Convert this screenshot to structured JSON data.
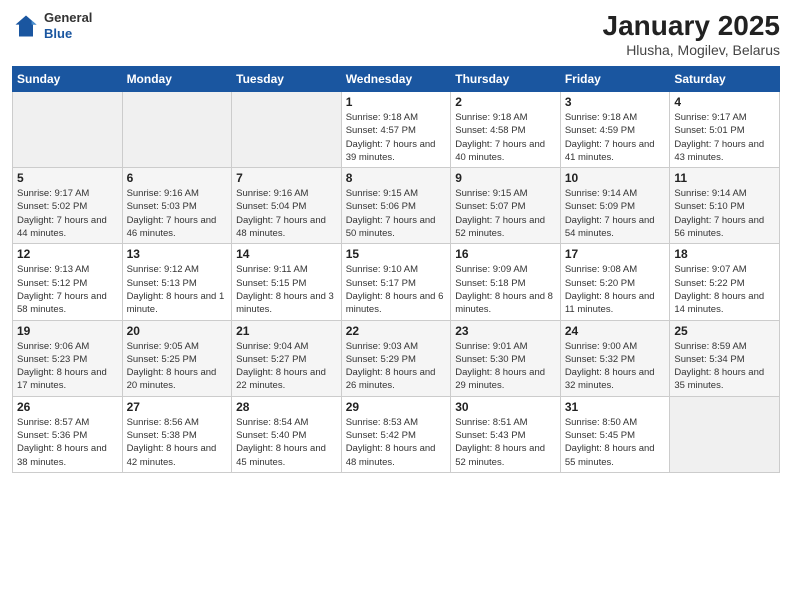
{
  "header": {
    "logo_general": "General",
    "logo_blue": "Blue",
    "title": "January 2025",
    "subtitle": "Hlusha, Mogilev, Belarus"
  },
  "days_of_week": [
    "Sunday",
    "Monday",
    "Tuesday",
    "Wednesday",
    "Thursday",
    "Friday",
    "Saturday"
  ],
  "weeks": [
    {
      "days": [
        {
          "num": "",
          "info": ""
        },
        {
          "num": "",
          "info": ""
        },
        {
          "num": "",
          "info": ""
        },
        {
          "num": "1",
          "info": "Sunrise: 9:18 AM\nSunset: 4:57 PM\nDaylight: 7 hours\nand 39 minutes."
        },
        {
          "num": "2",
          "info": "Sunrise: 9:18 AM\nSunset: 4:58 PM\nDaylight: 7 hours\nand 40 minutes."
        },
        {
          "num": "3",
          "info": "Sunrise: 9:18 AM\nSunset: 4:59 PM\nDaylight: 7 hours\nand 41 minutes."
        },
        {
          "num": "4",
          "info": "Sunrise: 9:17 AM\nSunset: 5:01 PM\nDaylight: 7 hours\nand 43 minutes."
        }
      ]
    },
    {
      "days": [
        {
          "num": "5",
          "info": "Sunrise: 9:17 AM\nSunset: 5:02 PM\nDaylight: 7 hours\nand 44 minutes."
        },
        {
          "num": "6",
          "info": "Sunrise: 9:16 AM\nSunset: 5:03 PM\nDaylight: 7 hours\nand 46 minutes."
        },
        {
          "num": "7",
          "info": "Sunrise: 9:16 AM\nSunset: 5:04 PM\nDaylight: 7 hours\nand 48 minutes."
        },
        {
          "num": "8",
          "info": "Sunrise: 9:15 AM\nSunset: 5:06 PM\nDaylight: 7 hours\nand 50 minutes."
        },
        {
          "num": "9",
          "info": "Sunrise: 9:15 AM\nSunset: 5:07 PM\nDaylight: 7 hours\nand 52 minutes."
        },
        {
          "num": "10",
          "info": "Sunrise: 9:14 AM\nSunset: 5:09 PM\nDaylight: 7 hours\nand 54 minutes."
        },
        {
          "num": "11",
          "info": "Sunrise: 9:14 AM\nSunset: 5:10 PM\nDaylight: 7 hours\nand 56 minutes."
        }
      ]
    },
    {
      "days": [
        {
          "num": "12",
          "info": "Sunrise: 9:13 AM\nSunset: 5:12 PM\nDaylight: 7 hours\nand 58 minutes."
        },
        {
          "num": "13",
          "info": "Sunrise: 9:12 AM\nSunset: 5:13 PM\nDaylight: 8 hours\nand 1 minute."
        },
        {
          "num": "14",
          "info": "Sunrise: 9:11 AM\nSunset: 5:15 PM\nDaylight: 8 hours\nand 3 minutes."
        },
        {
          "num": "15",
          "info": "Sunrise: 9:10 AM\nSunset: 5:17 PM\nDaylight: 8 hours\nand 6 minutes."
        },
        {
          "num": "16",
          "info": "Sunrise: 9:09 AM\nSunset: 5:18 PM\nDaylight: 8 hours\nand 8 minutes."
        },
        {
          "num": "17",
          "info": "Sunrise: 9:08 AM\nSunset: 5:20 PM\nDaylight: 8 hours\nand 11 minutes."
        },
        {
          "num": "18",
          "info": "Sunrise: 9:07 AM\nSunset: 5:22 PM\nDaylight: 8 hours\nand 14 minutes."
        }
      ]
    },
    {
      "days": [
        {
          "num": "19",
          "info": "Sunrise: 9:06 AM\nSunset: 5:23 PM\nDaylight: 8 hours\nand 17 minutes."
        },
        {
          "num": "20",
          "info": "Sunrise: 9:05 AM\nSunset: 5:25 PM\nDaylight: 8 hours\nand 20 minutes."
        },
        {
          "num": "21",
          "info": "Sunrise: 9:04 AM\nSunset: 5:27 PM\nDaylight: 8 hours\nand 22 minutes."
        },
        {
          "num": "22",
          "info": "Sunrise: 9:03 AM\nSunset: 5:29 PM\nDaylight: 8 hours\nand 26 minutes."
        },
        {
          "num": "23",
          "info": "Sunrise: 9:01 AM\nSunset: 5:30 PM\nDaylight: 8 hours\nand 29 minutes."
        },
        {
          "num": "24",
          "info": "Sunrise: 9:00 AM\nSunset: 5:32 PM\nDaylight: 8 hours\nand 32 minutes."
        },
        {
          "num": "25",
          "info": "Sunrise: 8:59 AM\nSunset: 5:34 PM\nDaylight: 8 hours\nand 35 minutes."
        }
      ]
    },
    {
      "days": [
        {
          "num": "26",
          "info": "Sunrise: 8:57 AM\nSunset: 5:36 PM\nDaylight: 8 hours\nand 38 minutes."
        },
        {
          "num": "27",
          "info": "Sunrise: 8:56 AM\nSunset: 5:38 PM\nDaylight: 8 hours\nand 42 minutes."
        },
        {
          "num": "28",
          "info": "Sunrise: 8:54 AM\nSunset: 5:40 PM\nDaylight: 8 hours\nand 45 minutes."
        },
        {
          "num": "29",
          "info": "Sunrise: 8:53 AM\nSunset: 5:42 PM\nDaylight: 8 hours\nand 48 minutes."
        },
        {
          "num": "30",
          "info": "Sunrise: 8:51 AM\nSunset: 5:43 PM\nDaylight: 8 hours\nand 52 minutes."
        },
        {
          "num": "31",
          "info": "Sunrise: 8:50 AM\nSunset: 5:45 PM\nDaylight: 8 hours\nand 55 minutes."
        },
        {
          "num": "",
          "info": ""
        }
      ]
    }
  ]
}
